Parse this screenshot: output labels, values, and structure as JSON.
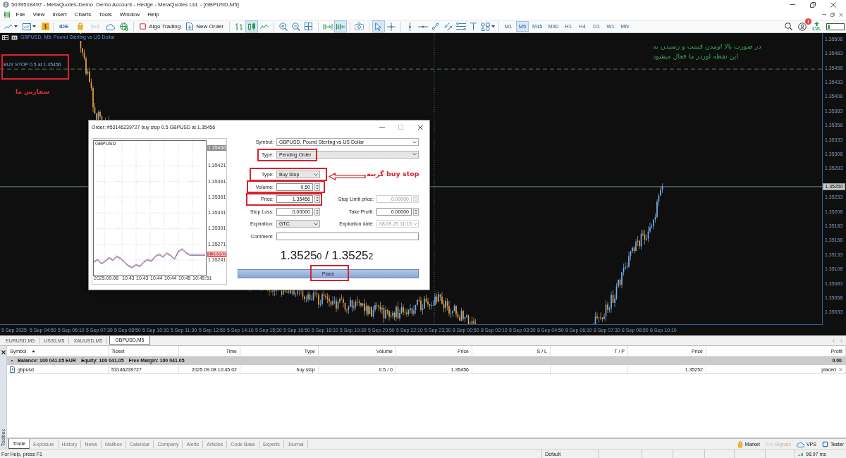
{
  "window": {
    "title": "5039518497 - MetaQuotes-Demo: Demo Account - Hedge - MetaQuotes Ltd. - [GBPUSD,M5]"
  },
  "menu": [
    "File",
    "View",
    "Insert",
    "Charts",
    "Tools",
    "Window",
    "Help"
  ],
  "toolbar": {
    "ide": "IDE",
    "signals_enabled": false,
    "algo_trading": {
      "label": "Algo Trading",
      "on": false
    },
    "new_order": "New Order",
    "chart_types": [
      {
        "selected": false
      },
      {
        "selected": true
      },
      {
        "selected": false
      }
    ],
    "auto_scroll": {
      "on": false
    },
    "chart_shift": {
      "on": true
    },
    "pointer_tools": [
      {
        "selected": true
      },
      {
        "selected": false
      }
    ],
    "timeframes": [
      {
        "label": "M1",
        "selected": false
      },
      {
        "label": "M5",
        "selected": true
      },
      {
        "label": "M15",
        "selected": false
      },
      {
        "label": "M30",
        "selected": false
      },
      {
        "label": "H1",
        "selected": false
      },
      {
        "label": "H4",
        "selected": false
      },
      {
        "label": "D1",
        "selected": false
      },
      {
        "label": "W1",
        "selected": false
      },
      {
        "label": "MN",
        "selected": false
      }
    ],
    "notification_count": "1",
    "level_label": "LVL",
    "usage_meter": {
      "level": 0.15
    }
  },
  "chart": {
    "title": "GBPUSD, M5: Pound Sterling vs US Dollar",
    "order_label": {
      "text": "BUY STOP 0.5 at 1.35456",
      "highlighted": true
    },
    "order_note": "سفارش ما",
    "explanation": "در صورت بالا اومدن قیمت و رسیدن به این نقطه اوردر ما فعال میشود",
    "price_ticks": [
      "1.35508",
      "1.35483",
      "1.35458",
      "1.35433",
      "1.35408",
      "1.35383",
      "1.35358",
      "1.35333",
      "1.35308",
      "1.35283",
      "1.35233",
      "1.35208",
      "1.35183",
      "1.35158",
      "1.35133",
      "1.35108",
      "1.35083",
      "1.35058",
      "1.35033"
    ],
    "current_price": "1.35250",
    "time_ticks": [
      "5 Sep 2025",
      "5 Sep 04:50",
      "5 Sep 06:10",
      "5 Sep 07:30",
      "5 Sep 08:50",
      "5 Sep 10:10",
      "5 Sep 11:30",
      "5 Sep 12:50",
      "5 Sep 14:10",
      "5 Sep 15:30",
      "5 Sep 16:50",
      "5 Sep 18:10",
      "5 Sep 19:30",
      "5 Sep 20:50",
      "5 Sep 22:10",
      "5 Sep 23:30",
      "8 Sep 00:50",
      "8 Sep 02:10",
      "8 Sep 03:30",
      "8 Sep 04:50",
      "8 Sep 06:10",
      "8 Sep 07:30",
      "8 Sep 08:50",
      "8 Sep 10:10"
    ]
  },
  "order_dialog": {
    "title": "Order: #53146239727 buy stop 0.5 GBPUSD at 1.35456",
    "mini_chart": {
      "symbol": "GBPUSD",
      "order_price": "1.35456",
      "current_price": "1.35252",
      "time_ticks": [
        "2025.09.08",
        "10:43",
        "10:43",
        "10:44",
        "10:44",
        "10:45",
        "10:45:51"
      ],
      "chart_data": {
        "type": "line",
        "grid": true,
        "ylim": [
          1.3521,
          1.3547
        ],
        "yticks": [
          {
            "value": 1.35421,
            "label": "1.35421"
          },
          {
            "value": 1.35391,
            "label": "1.35391"
          },
          {
            "value": 1.35361,
            "label": "1.35361"
          },
          {
            "value": 1.35331,
            "label": "1.35331"
          },
          {
            "value": 1.35301,
            "label": "1.35301"
          },
          {
            "value": 1.35271,
            "label": "1.35271"
          },
          {
            "value": 1.35241,
            "label": "1.35241"
          }
        ],
        "series": [
          {
            "color": "#4a5fb5",
            "values": [
              1.35236,
              1.35241,
              1.35233,
              1.35238,
              1.35244,
              1.3524,
              1.35247,
              1.35243,
              1.35236,
              1.35229,
              1.35226,
              1.35231,
              1.35228,
              1.35236,
              1.35241,
              1.35238,
              1.35247,
              1.35251,
              1.35246,
              1.35253,
              1.35249,
              1.35242,
              1.35256,
              1.35261,
              1.35254,
              1.3525,
              1.3525,
              1.3525,
              1.3525,
              1.3525
            ]
          },
          {
            "color": "#dd6666",
            "values": [
              1.35238,
              1.35243,
              1.35235,
              1.3524,
              1.35246,
              1.35242,
              1.35249,
              1.35245,
              1.35238,
              1.35231,
              1.35228,
              1.35233,
              1.3523,
              1.35238,
              1.35243,
              1.3524,
              1.35249,
              1.35253,
              1.35248,
              1.35255,
              1.35251,
              1.35244,
              1.35258,
              1.35263,
              1.35256,
              1.35252,
              1.35252,
              1.35252,
              1.35252,
              1.35252
            ]
          }
        ]
      }
    },
    "symbol": {
      "label": "Symbol:",
      "value": "GBPUSD, Pound Sterling vs US Dollar"
    },
    "type": {
      "label": "Type:",
      "value": "Pending Order",
      "highlighted": true
    },
    "order_type": {
      "label": "Type:",
      "value": "Buy Stop",
      "highlighted": true
    },
    "volume": {
      "label": "Volume:",
      "value": "0.50",
      "highlighted": true
    },
    "price": {
      "label": "Price:",
      "value": "1.35456",
      "highlighted": true
    },
    "stop_limit_price": {
      "label": "Stop Limit price:",
      "value": "0.00000",
      "disabled": true
    },
    "stop_loss": {
      "label": "Stop Loss:",
      "value": "0.00000"
    },
    "take_profit": {
      "label": "Take Profit:",
      "value": "0.00000"
    },
    "expiration": {
      "label": "Expiration:",
      "value": "GTC"
    },
    "expiration_date": {
      "label": "Expiration date:",
      "value": "08.09.25 11:15",
      "disabled": true
    },
    "comment": {
      "label": "Comment:"
    },
    "quote": "1.3525$_{0}$ / 1.3525$_{2}$",
    "place_button": {
      "label": "Place",
      "highlighted": true
    },
    "annotation": "buy stop گزینه"
  },
  "chart_tabs": [
    {
      "label": "EURUSD,M5",
      "selected": false
    },
    {
      "label": "US30,M5",
      "selected": false
    },
    {
      "label": "XAUUSD,M5",
      "selected": false
    },
    {
      "label": "GBPUSD,M5",
      "selected": true
    }
  ],
  "trade_table": {
    "columns": [
      {
        "label": "Symbol",
        "sorted": true
      },
      {
        "label": "Ticket",
        "sorted": false
      },
      {
        "label": "Time",
        "sorted": false
      },
      {
        "label": "Type",
        "sorted": false
      },
      {
        "label": "Volume",
        "sorted": false
      },
      {
        "label": "Price",
        "sorted": false
      },
      {
        "label": "S / L",
        "sorted": false
      },
      {
        "label": "T / P",
        "sorted": false
      },
      {
        "label": "Price",
        "sorted": false
      },
      {
        "label": "Profit",
        "sorted": false
      }
    ],
    "summary": {
      "balance": "Balance: 100 041.05 EUR",
      "equity": "Equity: 100 041.05",
      "free_margin": "Free Margin: 100 041.05",
      "profit": "0.00"
    },
    "rows": [
      {
        "symbol": "gbpusd",
        "ticket": "53146239727",
        "time": "2025.09.08 10:45:02",
        "type": "buy stop",
        "volume": "0.5 / 0",
        "price": "1.35456",
        "price_2": "1.35252",
        "profit": "placed"
      }
    ]
  },
  "toolbox_label": "Toolbox",
  "panel_tabs": [
    {
      "label": "Trade",
      "selected": true
    },
    {
      "label": "Exposure",
      "selected": false
    },
    {
      "label": "History",
      "selected": false
    },
    {
      "label": "News",
      "selected": false
    },
    {
      "label": "Mailbox",
      "selected": false
    },
    {
      "label": "Calendar",
      "selected": false
    },
    {
      "label": "Company",
      "selected": false
    },
    {
      "label": "Alerts",
      "selected": false
    },
    {
      "label": "Articles",
      "selected": false
    },
    {
      "label": "Code Base",
      "selected": false
    },
    {
      "label": "Experts",
      "selected": false
    },
    {
      "label": "Journal",
      "selected": false
    }
  ],
  "services": [
    {
      "label": "Market",
      "disabled": false
    },
    {
      "label": "Signals",
      "disabled": true
    },
    {
      "label": "VPS",
      "disabled": false
    },
    {
      "label": "Tester",
      "disabled": false
    }
  ],
  "status_bar": {
    "help": "For Help, press F1",
    "profile": "Default",
    "ping": "98.97 ms"
  }
}
